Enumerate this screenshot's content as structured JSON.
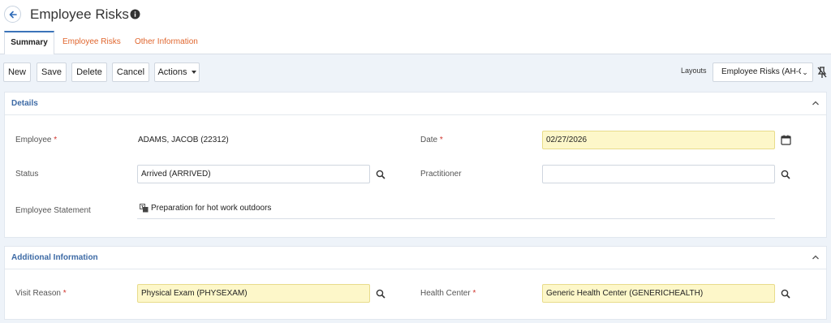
{
  "header": {
    "title": "Employee Risks"
  },
  "tabs": [
    {
      "label": "Summary"
    },
    {
      "label": "Employee Risks"
    },
    {
      "label": "Other Information"
    }
  ],
  "toolbar": {
    "new_label": "New",
    "save_label": "Save",
    "delete_label": "Delete",
    "cancel_label": "Cancel",
    "actions_label": "Actions",
    "layouts_label": "Layouts",
    "layouts_value": "Employee Risks (AH-C"
  },
  "details": {
    "title": "Details",
    "employee_label": "Employee",
    "employee_value": "ADAMS, JACOB (22312)",
    "date_label": "Date",
    "date_value": "02/27/2026",
    "status_label": "Status",
    "status_value": "Arrived (ARRIVED)",
    "practitioner_label": "Practitioner",
    "practitioner_value": "",
    "statement_label": "Employee Statement",
    "statement_value": "Preparation for hot work outdoors"
  },
  "additional": {
    "title": "Additional Information",
    "visit_reason_label": "Visit Reason",
    "visit_reason_value": "Physical Exam (PHYSEXAM)",
    "health_center_label": "Health Center",
    "health_center_value": "Generic Health Center (GENERICHEALTH)"
  },
  "required_marker": "*",
  "colors": {
    "accent_blue": "#3d6aa5",
    "tab_orange": "#e0662e",
    "required_red": "#d0342c",
    "required_field_bg": "#fdf7c9"
  }
}
